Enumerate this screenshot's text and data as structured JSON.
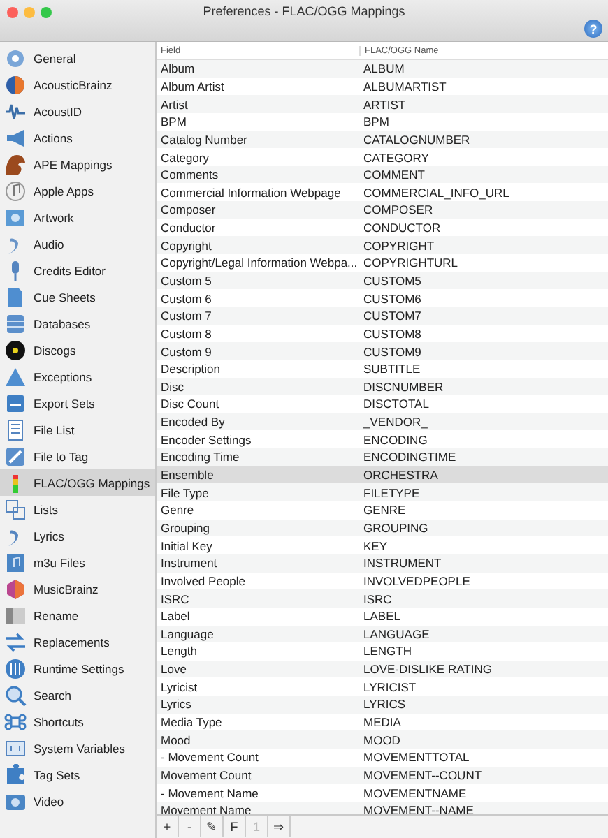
{
  "window": {
    "title": "Preferences - FLAC/OGG Mappings"
  },
  "toolbar": {
    "help_button": "?"
  },
  "sidebar": {
    "items": [
      {
        "label": "General",
        "selected": false
      },
      {
        "label": "AcousticBrainz",
        "selected": false
      },
      {
        "label": "AcoustID",
        "selected": false
      },
      {
        "label": "Actions",
        "selected": false
      },
      {
        "label": "APE Mappings",
        "selected": false
      },
      {
        "label": "Apple Apps",
        "selected": false
      },
      {
        "label": "Artwork",
        "selected": false
      },
      {
        "label": "Audio",
        "selected": false
      },
      {
        "label": "Credits Editor",
        "selected": false
      },
      {
        "label": "Cue Sheets",
        "selected": false
      },
      {
        "label": "Databases",
        "selected": false
      },
      {
        "label": "Discogs",
        "selected": false
      },
      {
        "label": "Exceptions",
        "selected": false
      },
      {
        "label": "Export Sets",
        "selected": false
      },
      {
        "label": "File List",
        "selected": false
      },
      {
        "label": "File to Tag",
        "selected": false
      },
      {
        "label": "FLAC/OGG Mappings",
        "selected": true
      },
      {
        "label": "Lists",
        "selected": false
      },
      {
        "label": "Lyrics",
        "selected": false
      },
      {
        "label": "m3u Files",
        "selected": false
      },
      {
        "label": "MusicBrainz",
        "selected": false
      },
      {
        "label": "Rename",
        "selected": false
      },
      {
        "label": "Replacements",
        "selected": false
      },
      {
        "label": "Runtime Settings",
        "selected": false
      },
      {
        "label": "Search",
        "selected": false
      },
      {
        "label": "Shortcuts",
        "selected": false
      },
      {
        "label": "System Variables",
        "selected": false
      },
      {
        "label": "Tag Sets",
        "selected": false
      },
      {
        "label": "Video",
        "selected": false
      }
    ]
  },
  "table": {
    "columns": [
      "Field",
      "FLAC/OGG Name"
    ],
    "rows": [
      {
        "field": "Album",
        "name": "ALBUM",
        "selected": false
      },
      {
        "field": "Album Artist",
        "name": "ALBUMARTIST",
        "selected": false
      },
      {
        "field": "Artist",
        "name": "ARTIST",
        "selected": false
      },
      {
        "field": "BPM",
        "name": "BPM",
        "selected": false
      },
      {
        "field": "Catalog Number",
        "name": "CATALOGNUMBER",
        "selected": false
      },
      {
        "field": "Category",
        "name": "CATEGORY",
        "selected": false
      },
      {
        "field": "Comments",
        "name": "COMMENT",
        "selected": false
      },
      {
        "field": "Commercial Information Webpage",
        "name": "COMMERCIAL_INFO_URL",
        "selected": false
      },
      {
        "field": "Composer",
        "name": "COMPOSER",
        "selected": false
      },
      {
        "field": "Conductor",
        "name": "CONDUCTOR",
        "selected": false
      },
      {
        "field": "Copyright",
        "name": "COPYRIGHT",
        "selected": false
      },
      {
        "field": "Copyright/Legal Information Webpa...",
        "name": "COPYRIGHTURL",
        "selected": false
      },
      {
        "field": "Custom 5",
        "name": "CUSTOM5",
        "selected": false
      },
      {
        "field": "Custom 6",
        "name": "CUSTOM6",
        "selected": false
      },
      {
        "field": "Custom 7",
        "name": "CUSTOM7",
        "selected": false
      },
      {
        "field": "Custom 8",
        "name": "CUSTOM8",
        "selected": false
      },
      {
        "field": "Custom 9",
        "name": "CUSTOM9",
        "selected": false
      },
      {
        "field": "Description",
        "name": "SUBTITLE",
        "selected": false
      },
      {
        "field": "Disc",
        "name": "DISCNUMBER",
        "selected": false
      },
      {
        "field": "Disc Count",
        "name": "DISCTOTAL",
        "selected": false
      },
      {
        "field": "Encoded By",
        "name": "_VENDOR_",
        "selected": false
      },
      {
        "field": "Encoder Settings",
        "name": "ENCODING",
        "selected": false
      },
      {
        "field": "Encoding Time",
        "name": "ENCODINGTIME",
        "selected": false
      },
      {
        "field": "Ensemble",
        "name": "ORCHESTRA",
        "selected": true
      },
      {
        "field": "File Type",
        "name": "FILETYPE",
        "selected": false
      },
      {
        "field": "Genre",
        "name": "GENRE",
        "selected": false
      },
      {
        "field": "Grouping",
        "name": "GROUPING",
        "selected": false
      },
      {
        "field": "Initial Key",
        "name": "KEY",
        "selected": false
      },
      {
        "field": "Instrument",
        "name": "INSTRUMENT",
        "selected": false
      },
      {
        "field": "Involved People",
        "name": "INVOLVEDPEOPLE",
        "selected": false
      },
      {
        "field": "ISRC",
        "name": "ISRC",
        "selected": false
      },
      {
        "field": "Label",
        "name": "LABEL",
        "selected": false
      },
      {
        "field": "Language",
        "name": "LANGUAGE",
        "selected": false
      },
      {
        "field": "Length",
        "name": "LENGTH",
        "selected": false
      },
      {
        "field": "Love",
        "name": "LOVE-DISLIKE RATING",
        "selected": false
      },
      {
        "field": "Lyricist",
        "name": "LYRICIST",
        "selected": false
      },
      {
        "field": "Lyrics",
        "name": "LYRICS",
        "selected": false
      },
      {
        "field": "Media Type",
        "name": "MEDIA",
        "selected": false
      },
      {
        "field": "Mood",
        "name": "MOOD",
        "selected": false
      },
      {
        "field": "- Movement Count",
        "name": "MOVEMENTTOTAL",
        "selected": false
      },
      {
        "field": "Movement Count",
        "name": "MOVEMENT--COUNT",
        "selected": false
      },
      {
        "field": "- Movement Name",
        "name": "MOVEMENTNAME",
        "selected": false
      },
      {
        "field": "Movement Name",
        "name": "MOVEMENT--NAME",
        "selected": false
      }
    ]
  },
  "bottom_bar": {
    "buttons": [
      {
        "label": "+",
        "disabled": false
      },
      {
        "label": "-",
        "disabled": false
      },
      {
        "label": "✎",
        "disabled": false
      },
      {
        "label": "F",
        "disabled": false
      },
      {
        "label": "1",
        "disabled": true
      },
      {
        "label": "⇒",
        "disabled": false
      }
    ]
  }
}
